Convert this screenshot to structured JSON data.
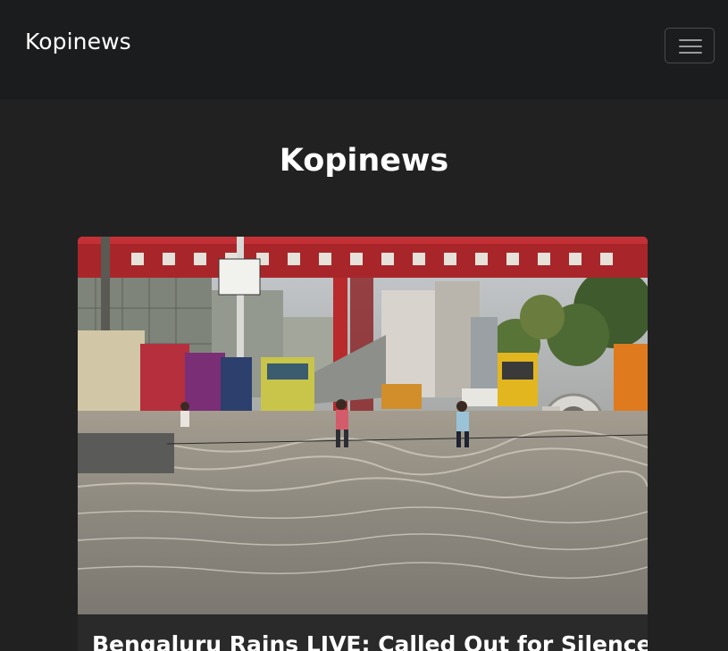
{
  "navbar": {
    "brand": "Kopinews",
    "toggle_icon": "hamburger-menu-icon"
  },
  "hero": {
    "title": "Kopinews"
  },
  "article": {
    "image_description": "flooded-city-road-photo",
    "title": "Bengaluru Rains LIVE: Called Out for Silence on"
  },
  "colors": {
    "background": "#212121",
    "navbar": "#1b1c1e",
    "card": "#2a2a2b",
    "text": "#ffffff"
  }
}
